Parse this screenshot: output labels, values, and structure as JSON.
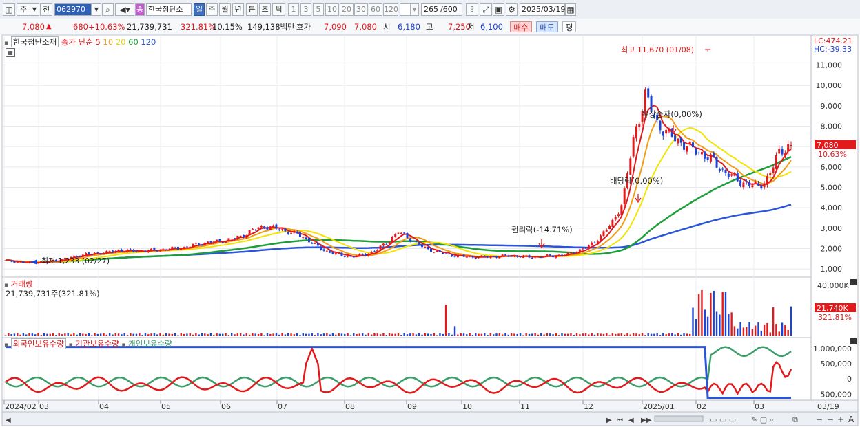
{
  "toolbar": {
    "market": "주",
    "prev_label": "전",
    "code": "062970",
    "name_badge": "종",
    "name": "한국첨단소",
    "periods": [
      "일",
      "주",
      "월",
      "년",
      "분",
      "초",
      "틱"
    ],
    "active_period": "일",
    "intervals": [
      "1",
      "3",
      "5",
      "10",
      "20",
      "30",
      "60",
      "120"
    ],
    "count": "265",
    "count_max": "/600",
    "date": "2025/03/19"
  },
  "quote": {
    "price": "7,080",
    "price_arrow": "▲",
    "change": "680",
    "change_pct": "+10.63%",
    "volume": "21,739,731",
    "volume_ratio": "321.81%",
    "turnover_pct": "10.15%",
    "amount": "149,138백만",
    "bid_label": "호가",
    "ask": "7,090",
    "bid": "7,080",
    "open_label": "시",
    "open": "6,180",
    "high_label": "고",
    "high": "7,250",
    "low_label": "저",
    "low": "6,100",
    "buy_button": "매수",
    "sell_button": "매도",
    "eval_button": "평"
  },
  "main_legend": {
    "stock_name": "한국첨단소재",
    "price_type": "종가 단순",
    "ma_periods": [
      "5",
      "10",
      "20",
      "60",
      "120"
    ],
    "ma_colors": [
      "#e31a1c",
      "#f39c12",
      "#f2e400",
      "#1e9e3a",
      "#2b55d9"
    ]
  },
  "colors": {
    "up": "#e31a1c",
    "down": "#1c44d6",
    "foreign": "#2b55d9",
    "institution": "#e31a1c",
    "individual": "#3a9d6a"
  },
  "annotations": {
    "high_marker": "최고 11,670 (01/08)",
    "low_marker": "최저 1,233 (02/27)",
    "rights": "권리락(-14.71%)",
    "dividend": "배당락(0.00%)",
    "paid_in": "유상증자(0,00%)",
    "lc": "LC:474.21",
    "hc": "HC:-39.33",
    "last_price_tag": "7,080",
    "last_pct_tag": "10.63%"
  },
  "volume_panel": {
    "title": "거래량",
    "value": "21,739,731주(321.81%)",
    "axis_max": "40,000K",
    "last_tag": "21,740K",
    "last_pct": "321.81%"
  },
  "holdings_panel": {
    "labels": [
      "외국인보유수량",
      "기관보유수량",
      "개인보유수량"
    ],
    "axis_labels": [
      "1,000,000",
      "500,000",
      "0",
      "-500,000"
    ]
  },
  "x_axis": {
    "labels": [
      "2024/02",
      "03",
      "04",
      "05",
      "06",
      "07",
      "08",
      "09",
      "10",
      "11",
      "12",
      "2025/01",
      "02",
      "03"
    ],
    "end_label": "03/19"
  },
  "chart_data": {
    "type": "candlestick",
    "title": "한국첨단소재",
    "y_axis_price": [
      "11,000",
      "10,000",
      "9,000",
      "8,000",
      "7,000",
      "6,000",
      "5,000",
      "4,000",
      "3,000",
      "2,000",
      "1,000"
    ],
    "ylim_price": [
      700,
      12300
    ],
    "monthly_close": [
      {
        "month": "2024/02",
        "close": 1400
      },
      {
        "month": "2024/03",
        "close": 1700
      },
      {
        "month": "2024/04",
        "close": 1900
      },
      {
        "month": "2024/05",
        "close": 1900
      },
      {
        "month": "2024/06",
        "close": 2300
      },
      {
        "month": "2024/07",
        "close": 2600
      },
      {
        "month": "2024/08",
        "close": 1600
      },
      {
        "month": "2024/09",
        "close": 2100
      },
      {
        "month": "2024/10",
        "close": 1600
      },
      {
        "month": "2024/11",
        "close": 1650
      },
      {
        "month": "2024/12",
        "close": 3200
      },
      {
        "month": "2025/01",
        "close": 7000
      },
      {
        "month": "2025/02",
        "close": 5300
      },
      {
        "month": "2025/03",
        "close": 7080
      }
    ],
    "high": 11670,
    "low": 1233,
    "last": 7080,
    "volume_ylim": [
      0,
      40000
    ],
    "holdings_ylim": [
      -650000,
      1200000
    ]
  }
}
